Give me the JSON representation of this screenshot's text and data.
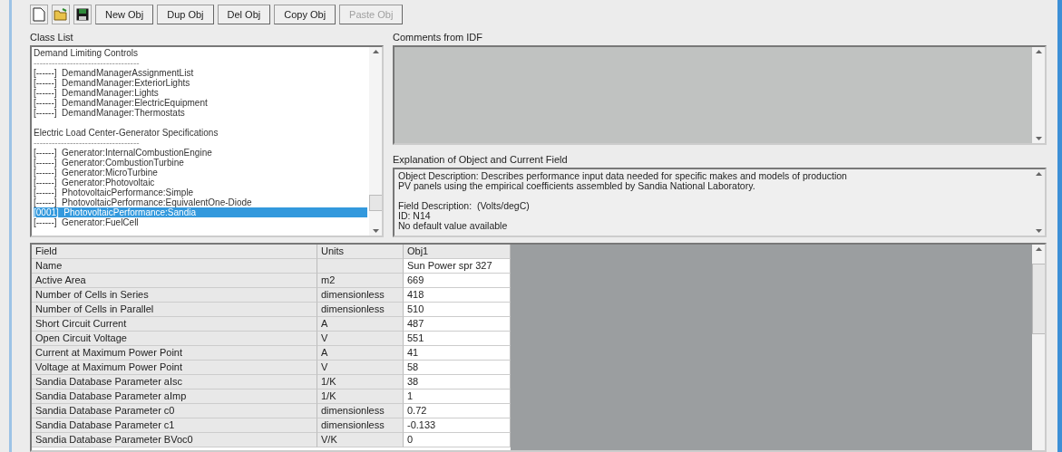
{
  "toolbar": {
    "icon_buttons": [
      {
        "kind": "new"
      },
      {
        "kind": "open"
      },
      {
        "kind": "save"
      }
    ],
    "buttons": [
      {
        "label": "New Obj",
        "disabled": false
      },
      {
        "label": "Dup Obj",
        "disabled": false
      },
      {
        "label": "Del Obj",
        "disabled": false
      },
      {
        "label": "Copy Obj",
        "disabled": false
      },
      {
        "label": "Paste Obj",
        "disabled": true
      }
    ]
  },
  "class_list": {
    "label": "Class List",
    "items": [
      {
        "kind": "header",
        "text": "Demand Limiting Controls"
      },
      {
        "kind": "separator",
        "text": "-----------------------------------"
      },
      {
        "kind": "item",
        "count": "[------]",
        "name": "DemandManagerAssignmentList",
        "selected": false
      },
      {
        "kind": "item",
        "count": "[------]",
        "name": "DemandManager:ExteriorLights",
        "selected": false
      },
      {
        "kind": "item",
        "count": "[------]",
        "name": "DemandManager:Lights",
        "selected": false
      },
      {
        "kind": "item",
        "count": "[------]",
        "name": "DemandManager:ElectricEquipment",
        "selected": false
      },
      {
        "kind": "item",
        "count": "[------]",
        "name": "DemandManager:Thermostats",
        "selected": false
      },
      {
        "kind": "blank"
      },
      {
        "kind": "header",
        "text": "Electric Load Center-Generator Specifications"
      },
      {
        "kind": "separator",
        "text": "-----------------------------------"
      },
      {
        "kind": "item",
        "count": "[------]",
        "name": "Generator:InternalCombustionEngine",
        "selected": false
      },
      {
        "kind": "item",
        "count": "[------]",
        "name": "Generator:CombustionTurbine",
        "selected": false
      },
      {
        "kind": "item",
        "count": "[------]",
        "name": "Generator:MicroTurbine",
        "selected": false
      },
      {
        "kind": "item",
        "count": "[------]",
        "name": "Generator:Photovoltaic",
        "selected": false
      },
      {
        "kind": "item",
        "count": "[------]",
        "name": "PhotovoltaicPerformance:Simple",
        "selected": false
      },
      {
        "kind": "item",
        "count": "[------]",
        "name": "PhotovoltaicPerformance:EquivalentOne-Diode",
        "selected": false
      },
      {
        "kind": "item",
        "count": "[0001]",
        "name": "PhotovoltaicPerformance:Sandia",
        "selected": true
      },
      {
        "kind": "item",
        "count": "[------]",
        "name": "Generator:FuelCell",
        "selected": false
      }
    ]
  },
  "comments": {
    "label": "Comments from IDF"
  },
  "explanation": {
    "label": "Explanation of Object and Current Field",
    "paragraphs": [
      [
        "Object Description: Describes performance input data needed for specific makes and models of production",
        "PV panels using the empirical coefficients assembled by Sandia National Laboratory."
      ],
      [
        "Field Description:  (Volts/degC)",
        "ID: N14",
        "No default value available"
      ]
    ]
  },
  "table": {
    "columns": [
      "Field",
      "Units",
      "Obj1"
    ],
    "rows": [
      [
        "Name",
        "",
        "Sun Power spr 327"
      ],
      [
        "Active Area",
        "m2",
        "669"
      ],
      [
        "Number of Cells in Series",
        "dimensionless",
        "418"
      ],
      [
        "Number of Cells in Parallel",
        "dimensionless",
        "510"
      ],
      [
        "Short Circuit Current",
        "A",
        "487"
      ],
      [
        "Open Circuit Voltage",
        "V",
        "551"
      ],
      [
        "Current at Maximum Power Point",
        "A",
        "41"
      ],
      [
        "Voltage at Maximum Power Point",
        "V",
        "58"
      ],
      [
        "Sandia Database Parameter aIsc",
        "1/K",
        "38"
      ],
      [
        "Sandia Database Parameter aImp",
        "1/K",
        "1"
      ],
      [
        "Sandia Database Parameter c0",
        "dimensionless",
        "0.72"
      ],
      [
        "Sandia Database Parameter c1",
        "dimensionless",
        "-0.133"
      ],
      [
        "Sandia Database Parameter BVoc0",
        "V/K",
        "0"
      ]
    ]
  }
}
